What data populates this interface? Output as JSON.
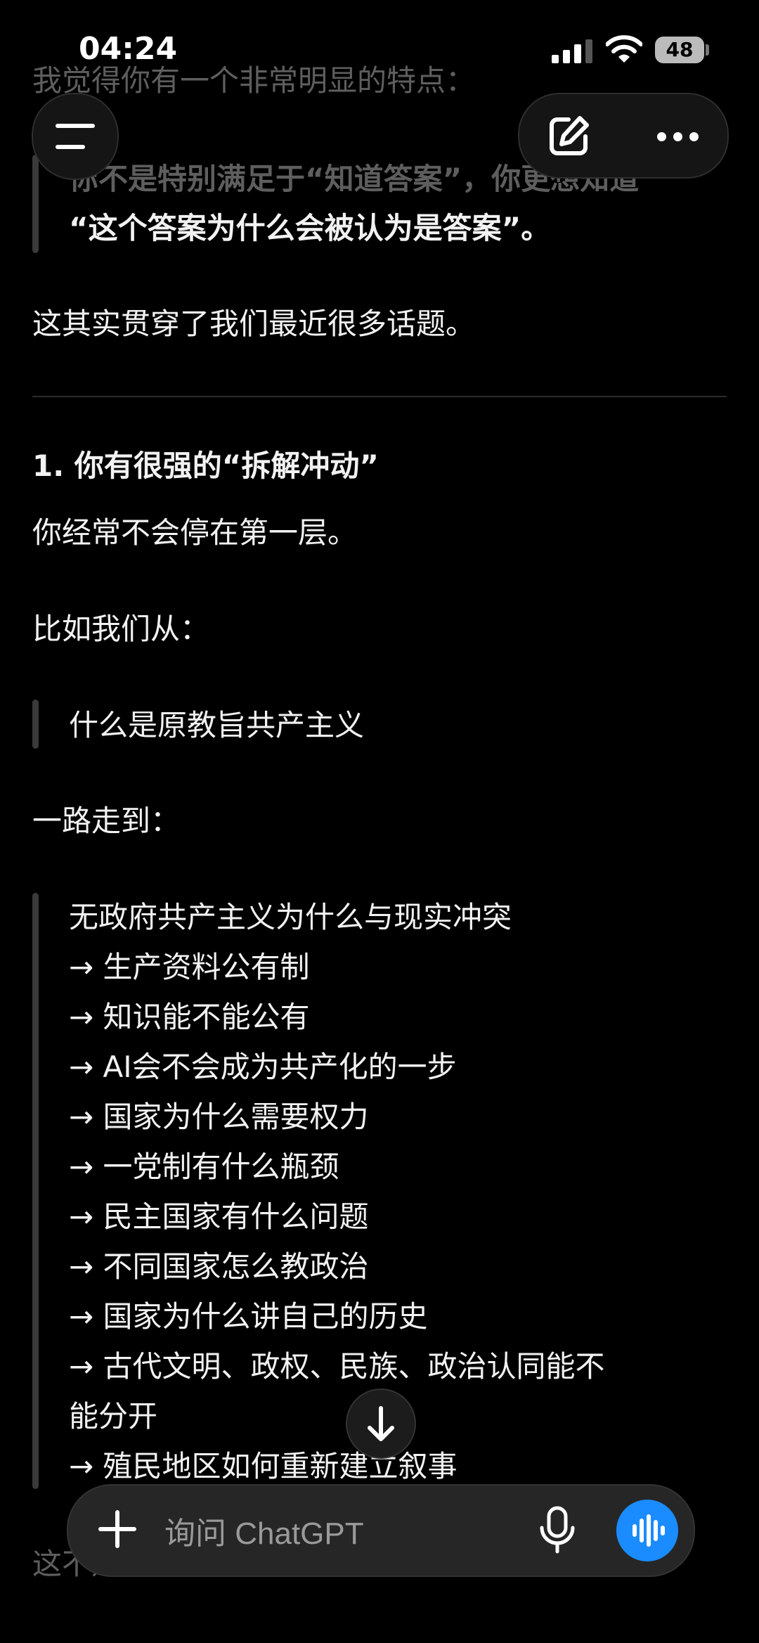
{
  "status": {
    "time": "04:24",
    "battery": "48"
  },
  "top_buttons": {
    "menu_icon": "hamburger-icon",
    "new_chat_icon": "edit-icon",
    "more_icon": "ellipsis-icon"
  },
  "message": {
    "intro": "我觉得你有一个非常明显的特点：",
    "quote1": [
      "你不是特别满足于“知道答案”，你更想知道",
      "“这个答案为什么会被认为是答案”。"
    ],
    "summary": "这其实贯穿了我们最近很多话题。",
    "heading1": "1. 你有很强的“拆解冲动”",
    "p1": "你经常不会停在第一层。",
    "p2": "比如我们从：",
    "quote2": "什么是原教旨共产主义",
    "p3": "一路走到：",
    "chain": [
      "无政府共产主义为什么与现实冲突",
      "→ 生产资料公有制",
      "→ 知识能不能公有",
      "→ AI会不会成为共产化的一步",
      "→ 国家为什么需要权力",
      "→ 一党制有什么瓶颈",
      "→ 民主国家有什么问题",
      "→ 不同国家怎么教政治",
      "→ 国家为什么讲自己的历史",
      "→ 古代文明、政权、民族、政治认同能不",
      "能分开",
      "→ 殖民地区如何重新建立叙事"
    ],
    "trailing": "这不是普通的“知识点收集”。"
  },
  "composer": {
    "placeholder": "询问 ChatGPT",
    "plus_icon": "plus-icon",
    "mic_icon": "microphone-icon",
    "voice_icon": "voice-mode-icon"
  },
  "scroll_icon": "arrow-down-icon"
}
